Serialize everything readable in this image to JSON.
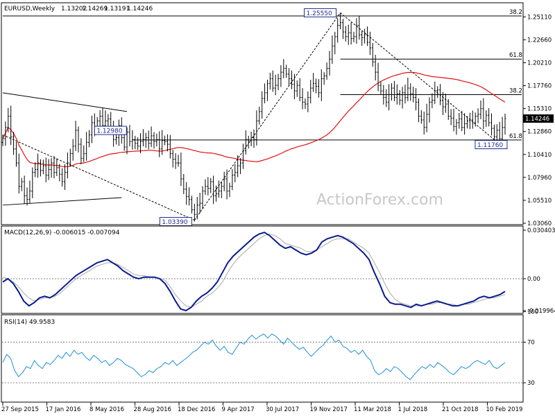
{
  "watermark": "ActionForex.com",
  "colors": {
    "candle": "#000000",
    "ma": "#e01010",
    "macd": "#0a1a8c",
    "signal": "#a9a9a9",
    "rsi": "#1e90d8",
    "label_box": "#1a2a8c",
    "grid": "#808080",
    "current_box": "#000000"
  },
  "chart_data": [
    {
      "type": "candlestick",
      "title": "EURUSD,Weekly",
      "ohlc_header": [
        "1.13202",
        "1.14269",
        "1.13191",
        "1.14246"
      ],
      "ylim": [
        1.0306,
        1.2558
      ],
      "y_ticks": [
        "1.25110",
        "1.22660",
        "1.20210",
        "1.17760",
        "1.15310",
        "1.12860",
        "1.10410",
        "1.07960",
        "1.05510",
        "1.03060"
      ],
      "current_price": "1.14246",
      "x_ticks": [
        "27 Sep 2015",
        "17 Jan 2016",
        "8 May 2016",
        "28 Aug 2016",
        "18 Dec 2016",
        "9 Apr 2017",
        "30 Jul 2017",
        "19 Nov 2017",
        "11 Mar 2018",
        "1 Jul 2018",
        "21 Oct 2018",
        "10 Feb 2019"
      ],
      "closes": [
        1.121,
        1.133,
        1.145,
        1.123,
        1.11,
        1.095,
        1.07,
        1.075,
        1.06,
        1.056,
        1.065,
        1.085,
        1.088,
        1.095,
        1.087,
        1.092,
        1.082,
        1.088,
        1.095,
        1.085,
        1.09,
        1.083,
        1.075,
        1.085,
        1.095,
        1.105,
        1.113,
        1.13,
        1.115,
        1.1,
        1.105,
        1.117,
        1.125,
        1.138,
        1.13,
        1.14,
        1.145,
        1.135,
        1.14,
        1.142,
        1.13,
        1.12,
        1.122,
        1.135,
        1.122,
        1.112,
        1.128,
        1.118,
        1.12,
        1.116,
        1.113,
        1.118,
        1.12,
        1.122,
        1.116,
        1.124,
        1.118,
        1.12,
        1.11,
        1.119,
        1.118,
        1.115,
        1.105,
        1.099,
        1.095,
        1.095,
        1.078,
        1.067,
        1.059,
        1.056,
        1.045,
        1.04,
        1.05,
        1.052,
        1.065,
        1.07,
        1.068,
        1.075,
        1.06,
        1.062,
        1.065,
        1.07,
        1.078,
        1.065,
        1.07,
        1.082,
        1.085,
        1.092,
        1.095,
        1.108,
        1.12,
        1.118,
        1.122,
        1.12,
        1.14,
        1.15,
        1.164,
        1.17,
        1.18,
        1.185,
        1.175,
        1.178,
        1.185,
        1.192,
        1.196,
        1.19,
        1.185,
        1.179,
        1.172,
        1.178,
        1.165,
        1.16,
        1.158,
        1.165,
        1.175,
        1.18,
        1.177,
        1.17,
        1.185,
        1.188,
        1.196,
        1.206,
        1.22,
        1.23,
        1.242,
        1.245,
        1.235,
        1.23,
        1.234,
        1.228,
        1.23,
        1.242,
        1.232,
        1.229,
        1.232,
        1.224,
        1.218,
        1.203,
        1.192,
        1.178,
        1.172,
        1.165,
        1.16,
        1.168,
        1.175,
        1.165,
        1.169,
        1.162,
        1.17,
        1.165,
        1.175,
        1.169,
        1.165,
        1.16,
        1.145,
        1.141,
        1.133,
        1.147,
        1.16,
        1.162,
        1.172,
        1.173,
        1.162,
        1.155,
        1.158,
        1.145,
        1.143,
        1.134,
        1.138,
        1.142,
        1.133,
        1.137,
        1.14,
        1.141,
        1.138,
        1.145,
        1.147,
        1.153,
        1.14,
        1.146,
        1.138,
        1.132,
        1.123,
        1.13,
        1.121,
        1.133,
        1.1425
      ],
      "ma_last": 1.157,
      "swing_labels": [
        {
          "text": "1.25550",
          "price": 1.2555
        },
        {
          "text": "1.12980",
          "price": 1.1298
        },
        {
          "text": "1.03390",
          "price": 1.0339
        },
        {
          "text": "1.11760",
          "price": 1.1176
        }
      ],
      "fib_labels": [
        {
          "text": "38.2",
          "price": 1.2521
        },
        {
          "text": "61.8",
          "price": 1.206
        },
        {
          "text": "38.2",
          "price": 1.168
        },
        {
          "text": "61.8",
          "price": 1.1196
        }
      ]
    },
    {
      "type": "line",
      "title": "MACD(12,26,9) -0.006015 -0.007094",
      "ylim": [
        -0.02,
        0.0304
      ],
      "y_ticks": [
        "0.030403",
        "0.00",
        "-0.019964"
      ],
      "series": [
        {
          "values": [
            -0.002,
            0.0,
            -0.003,
            -0.008,
            -0.014,
            -0.017,
            -0.015,
            -0.012,
            -0.011,
            -0.012,
            -0.01,
            -0.007,
            -0.004,
            -0.001,
            0.002,
            0.004,
            0.006,
            0.008,
            0.01,
            0.011,
            0.012,
            0.01,
            0.008,
            0.005,
            0.003,
            0.001,
            0.0,
            0.001,
            0.001,
            0.001,
            0.0,
            -0.003,
            -0.008,
            -0.014,
            -0.019,
            -0.02,
            -0.018,
            -0.014,
            -0.011,
            -0.009,
            -0.006,
            -0.002,
            0.004,
            0.01,
            0.014,
            0.017,
            0.02,
            0.023,
            0.026,
            0.028,
            0.029,
            0.027,
            0.024,
            0.021,
            0.019,
            0.02,
            0.018,
            0.016,
            0.015,
            0.016,
            0.018,
            0.023,
            0.025,
            0.026,
            0.027,
            0.026,
            0.024,
            0.022,
            0.019,
            0.016,
            0.012,
            0.004,
            -0.003,
            -0.011,
            -0.015,
            -0.016,
            -0.016,
            -0.017,
            -0.018,
            -0.016,
            -0.017,
            -0.016,
            -0.015,
            -0.014,
            -0.015,
            -0.016,
            -0.017,
            -0.017,
            -0.016,
            -0.015,
            -0.014,
            -0.012,
            -0.011,
            -0.012,
            -0.011,
            -0.01,
            -0.008
          ]
        },
        {
          "values": [
            0.001,
            0.0,
            -0.002,
            -0.005,
            -0.009,
            -0.012,
            -0.014,
            -0.013,
            -0.012,
            -0.012,
            -0.011,
            -0.009,
            -0.006,
            -0.003,
            0.0,
            0.002,
            0.004,
            0.006,
            0.008,
            0.009,
            0.01,
            0.01,
            0.009,
            0.007,
            0.005,
            0.003,
            0.002,
            0.002,
            0.001,
            0.001,
            0.0,
            -0.001,
            -0.005,
            -0.01,
            -0.014,
            -0.017,
            -0.018,
            -0.016,
            -0.014,
            -0.011,
            -0.009,
            -0.006,
            -0.002,
            0.004,
            0.009,
            0.013,
            0.016,
            0.019,
            0.022,
            0.025,
            0.027,
            0.028,
            0.027,
            0.025,
            0.022,
            0.021,
            0.02,
            0.019,
            0.017,
            0.017,
            0.018,
            0.02,
            0.022,
            0.024,
            0.025,
            0.025,
            0.025,
            0.023,
            0.021,
            0.019,
            0.016,
            0.01,
            0.004,
            -0.003,
            -0.009,
            -0.013,
            -0.015,
            -0.016,
            -0.017,
            -0.017,
            -0.017,
            -0.016,
            -0.016,
            -0.015,
            -0.015,
            -0.016,
            -0.016,
            -0.017,
            -0.016,
            -0.016,
            -0.015,
            -0.014,
            -0.013,
            -0.012,
            -0.012,
            -0.011,
            -0.01
          ]
        }
      ]
    },
    {
      "type": "line",
      "title": "RSI(14) 49.9583",
      "ylim": [
        0,
        100
      ],
      "y_ticks": [
        "100",
        "70",
        "30"
      ],
      "levels": [
        70,
        30
      ],
      "series": [
        {
          "values": [
            50,
            58,
            54,
            42,
            36,
            40,
            46,
            44,
            52,
            47,
            44,
            50,
            48,
            52,
            57,
            54,
            60,
            56,
            62,
            58,
            60,
            55,
            52,
            57,
            54,
            50,
            52,
            47,
            50,
            54,
            52,
            48,
            46,
            44,
            40,
            36,
            38,
            42,
            40,
            44,
            46,
            50,
            48,
            52,
            47,
            50,
            53,
            56,
            60,
            62,
            66,
            70,
            68,
            72,
            66,
            62,
            66,
            60,
            58,
            64,
            70,
            68,
            73,
            77,
            73,
            76,
            78,
            74,
            78,
            76,
            72,
            68,
            74,
            70,
            66,
            63,
            65,
            60,
            56,
            60,
            64,
            67,
            72,
            76,
            70,
            72,
            66,
            64,
            60,
            62,
            58,
            62,
            56,
            52,
            42,
            38,
            40,
            44,
            41,
            46,
            44,
            40,
            36,
            33,
            38,
            42,
            46,
            44,
            48,
            45,
            50,
            47,
            44,
            40,
            38,
            42,
            46,
            44,
            46,
            50,
            52,
            50,
            48,
            52,
            46,
            44,
            47,
            50
          ]
        }
      ]
    }
  ],
  "date_axis_labels": [
    "27 Sep 2015",
    "17 Jan 2016",
    "8 May 2016",
    "28 Aug 2016",
    "18 Dec 2016",
    "9 Apr 2017",
    "30 Jul 2017",
    "19 Nov 2017",
    "11 Mar 2018",
    "1 Jul 2018",
    "21 Oct 2018",
    "10 Feb 2019"
  ]
}
